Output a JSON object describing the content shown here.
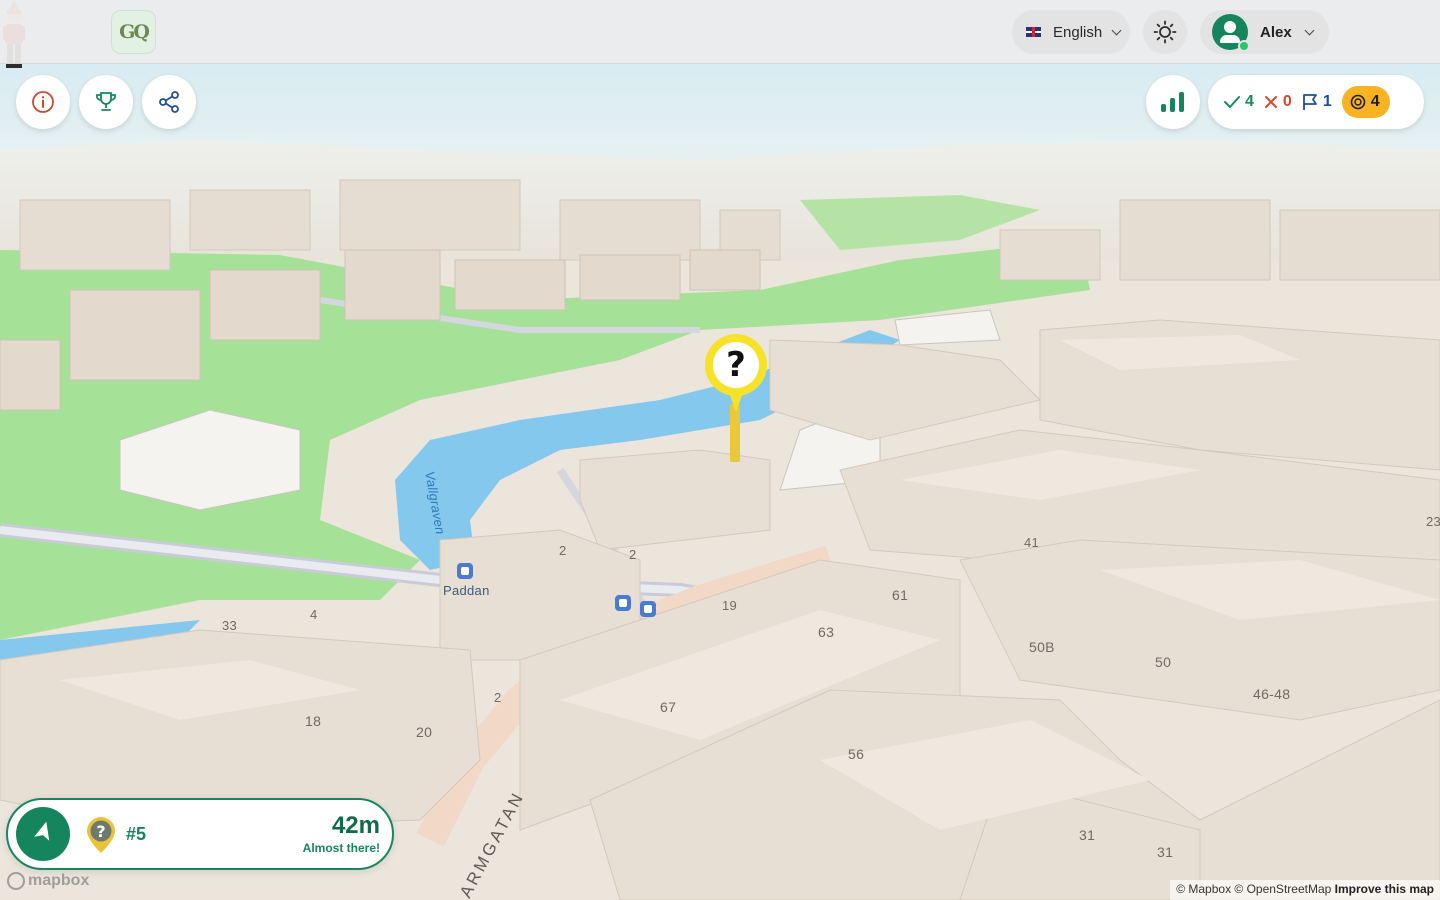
{
  "header": {
    "logo_text": "GQ",
    "language": "English",
    "user_name": "Alex"
  },
  "scoreboard": {
    "correct": "4",
    "wrong": "0",
    "flags": "1",
    "coins": "4"
  },
  "pin_symbol": "?",
  "navigation": {
    "question_number": "#5",
    "distance": "42m",
    "status": "Almost there!"
  },
  "map": {
    "labels": {
      "water": "Vallgraven",
      "poi": "Paddan",
      "street": "ARMGATAN",
      "n2a": "2",
      "n2b": "2",
      "n19": "19",
      "n41": "41",
      "n61": "61",
      "n63": "63",
      "n33": "33",
      "n4": "4",
      "n50b": "50B",
      "n50": "50",
      "n4648": "46-48",
      "n23": "23",
      "n18": "18",
      "n20": "20",
      "n2c": "2",
      "n67": "67",
      "n56": "56",
      "n31a": "31",
      "n31b": "31"
    }
  },
  "footer": {
    "mapbox": "mapbox",
    "attribution": "© Mapbox © OpenStreetMap",
    "improve": "Improve this map"
  },
  "colors": {
    "brand_green": "#15855e",
    "pin_yellow": "#f7e22a",
    "coin_orange": "#f7b323",
    "wrong_red": "#d14a2a",
    "flag_blue": "#1f4f9c",
    "water": "#7fc6ec",
    "park": "#9fe08f",
    "building": "#e6ddd2"
  },
  "icons": [
    "info-icon",
    "trophy-icon",
    "share-icon",
    "bar-chart-icon",
    "check-icon",
    "cross-icon",
    "flag-icon",
    "coin-icon",
    "sun-icon",
    "navigation-arrow-icon",
    "question-marker-icon"
  ]
}
